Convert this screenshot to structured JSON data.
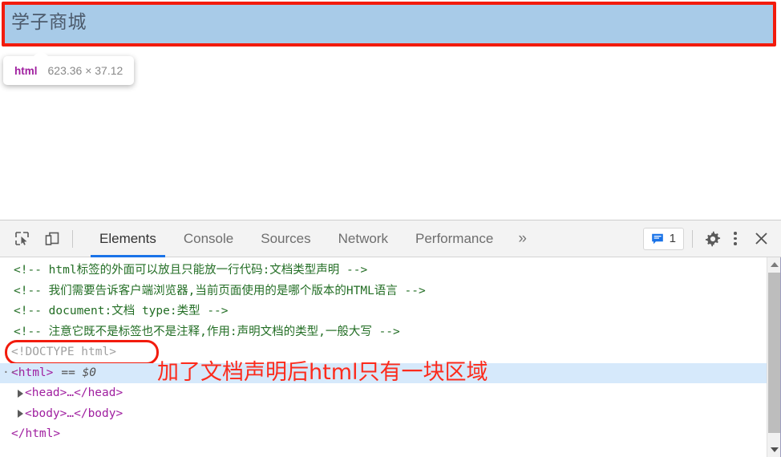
{
  "page": {
    "heading": "学子商城",
    "highlight_color": "#a8cbe8",
    "highlight_border_color": "#f21b0c"
  },
  "tooltip": {
    "tag": "html",
    "dimensions": "623.36 × 37.12"
  },
  "devtools": {
    "toolbar": {
      "inspect_icon": "inspect-element-icon",
      "device_icon": "device-toolbar-icon",
      "settings_icon": "gear-icon",
      "more_icon": "kebab-menu-icon",
      "close_icon": "close-icon",
      "overflow_label": "»",
      "message_count": "1",
      "message_icon": "message-bubble-icon"
    },
    "tabs": [
      {
        "label": "Elements",
        "active": true
      },
      {
        "label": "Console",
        "active": false
      },
      {
        "label": "Sources",
        "active": false
      },
      {
        "label": "Network",
        "active": false
      },
      {
        "label": "Performance",
        "active": false
      }
    ],
    "dom_lines": {
      "comment_1": "<!-- html标签的外面可以放且只能放一行代码:文档类型声明 -->",
      "comment_2": "<!-- 我们需要告诉客户端浏览器,当前页面使用的是哪个版本的HTML语言 -->",
      "comment_3": "<!-- document:文档 type:类型 -->",
      "comment_4": "<!-- 注意它既不是标签也不是注释,作用:声明文档的类型,一般大写 -->",
      "doctype": "<!DOCTYPE html>",
      "html_open_dots": "···",
      "html_open": "<html>",
      "html_selected_marker": "== $0",
      "head": "<head>…</head>",
      "body": "<body>…</body>",
      "html_close": "</html>"
    },
    "annotation": {
      "text": "加了文档声明后html只有一块区域",
      "color": "#fc2b1c"
    },
    "accent_color": "#1a73e8",
    "tag_color": "#a020a0",
    "comment_color": "#236e25",
    "selected_row_color": "#d6e9fb"
  }
}
